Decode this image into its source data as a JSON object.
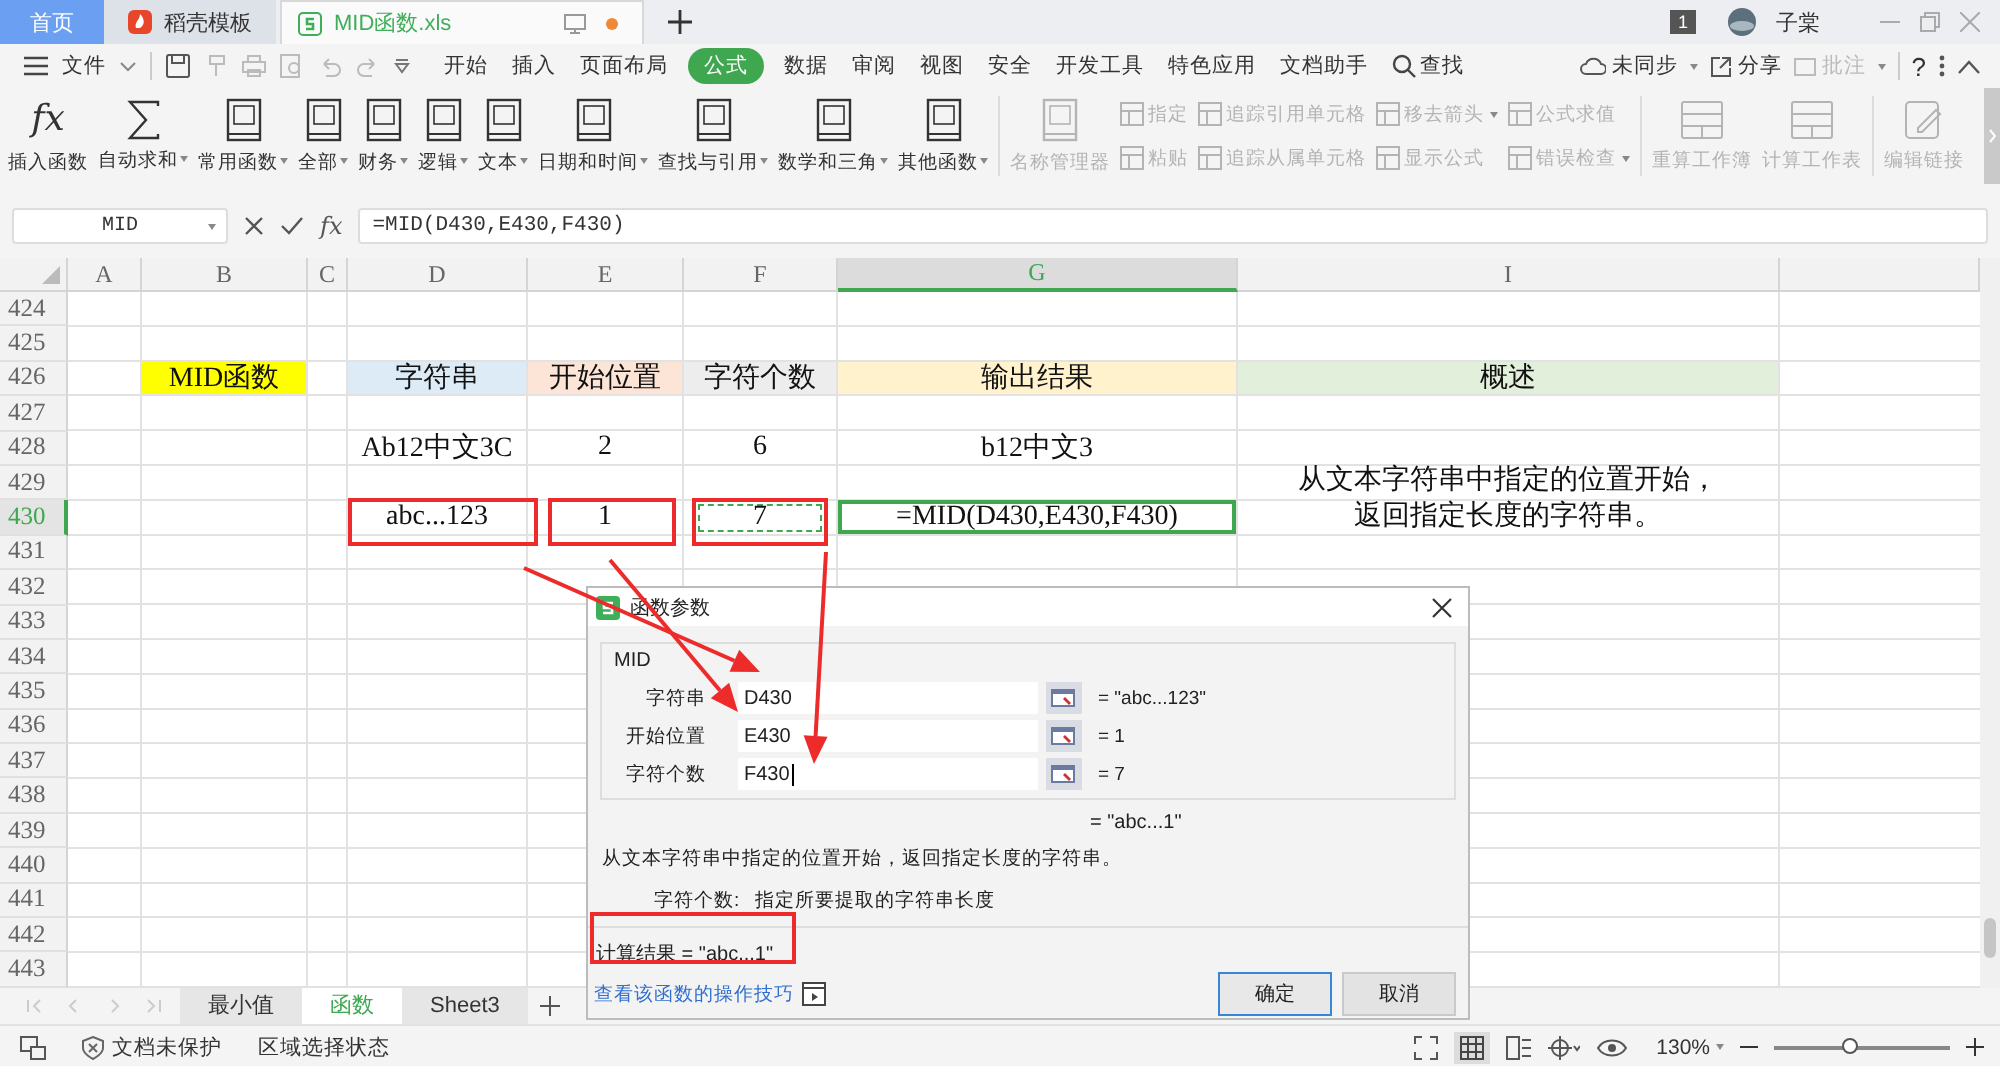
{
  "title_bar": {
    "tabs": [
      {
        "label": "首页",
        "kind": "home",
        "selected": false
      },
      {
        "label": "稻壳模板",
        "kind": "docer",
        "selected": false
      },
      {
        "label": "MID函数.xls",
        "kind": "sheet",
        "selected": true
      }
    ],
    "badge": "1",
    "user": "子棠"
  },
  "menu": {
    "file": "文件",
    "tabs": [
      {
        "label": "开始",
        "selected": false
      },
      {
        "label": "插入",
        "selected": false
      },
      {
        "label": "页面布局",
        "selected": false
      },
      {
        "label": "公式",
        "selected": true
      },
      {
        "label": "数据",
        "selected": false
      },
      {
        "label": "审阅",
        "selected": false
      },
      {
        "label": "视图",
        "selected": false
      },
      {
        "label": "安全",
        "selected": false
      },
      {
        "label": "开发工具",
        "selected": false
      },
      {
        "label": "特色应用",
        "selected": false
      },
      {
        "label": "文档助手",
        "selected": false
      }
    ],
    "search": "查找",
    "sync": "未同步",
    "share": "分享",
    "comment": "批注",
    "help": "?"
  },
  "ribbon": [
    {
      "kind": "fx",
      "icon_text": "fx",
      "label": "插入函数",
      "dropdown": false,
      "disabled": false
    },
    {
      "kind": "sigma",
      "label": "自动求和",
      "dropdown": true,
      "disabled": false
    },
    {
      "kind": "book",
      "label": "常用函数",
      "dropdown": true,
      "disabled": false
    },
    {
      "kind": "book",
      "label": "全部",
      "dropdown": true,
      "disabled": false
    },
    {
      "kind": "book",
      "label": "财务",
      "dropdown": true,
      "disabled": false
    },
    {
      "kind": "book",
      "label": "逻辑",
      "dropdown": true,
      "disabled": false
    },
    {
      "kind": "book",
      "label": "文本",
      "dropdown": true,
      "disabled": false
    },
    {
      "kind": "book",
      "label": "日期和时间",
      "dropdown": true,
      "disabled": false
    },
    {
      "kind": "book",
      "label": "查找与引用",
      "dropdown": true,
      "disabled": false
    },
    {
      "kind": "book",
      "label": "数学和三角",
      "dropdown": true,
      "disabled": false
    },
    {
      "kind": "book",
      "label": "其他函数",
      "dropdown": true,
      "disabled": false
    },
    {
      "kind": "book",
      "label": "名称管理器",
      "dropdown": false,
      "disabled": true
    },
    {
      "kind": "pair",
      "items": [
        {
          "label": "指定",
          "dropdown": false,
          "disabled": true
        },
        {
          "label": "粘贴",
          "dropdown": false,
          "disabled": true
        }
      ]
    },
    {
      "kind": "pair",
      "items": [
        {
          "label": "追踪引用单元格",
          "dropdown": false,
          "disabled": true
        },
        {
          "label": "追踪从属单元格",
          "dropdown": false,
          "disabled": true
        }
      ]
    },
    {
      "kind": "pair",
      "items": [
        {
          "label": "移去箭头",
          "dropdown": true,
          "disabled": true
        },
        {
          "label": "显示公式",
          "dropdown": false,
          "disabled": true
        }
      ]
    },
    {
      "kind": "pair",
      "items": [
        {
          "label": "公式求值",
          "dropdown": false,
          "disabled": true
        },
        {
          "label": "错误检查",
          "dropdown": true,
          "disabled": true
        }
      ]
    },
    {
      "kind": "table",
      "label": "重算工作簿",
      "dropdown": false,
      "disabled": true
    },
    {
      "kind": "table",
      "label": "计算工作表",
      "dropdown": false,
      "disabled": true
    },
    {
      "kind": "edit",
      "label": "编辑链接",
      "dropdown": false,
      "disabled": true
    }
  ],
  "formula_bar": {
    "name_box": "MID",
    "fx_label": "fx",
    "formula": "=MID(D430,E430,F430)"
  },
  "sheet": {
    "columns": [
      {
        "label": "A",
        "selected": false
      },
      {
        "label": "B",
        "selected": false
      },
      {
        "label": "C",
        "selected": false
      },
      {
        "label": "D",
        "selected": false
      },
      {
        "label": "E",
        "selected": false
      },
      {
        "label": "F",
        "selected": false
      },
      {
        "label": "G",
        "selected": true
      },
      {
        "label": "I",
        "selected": false
      }
    ],
    "rows": [
      {
        "number": "424",
        "selected": false
      },
      {
        "number": "425",
        "selected": false
      },
      {
        "number": "426",
        "selected": false,
        "cells": [
          null,
          {
            "text": "MID函数",
            "color": "#ffff00"
          },
          null,
          {
            "text": "字符串",
            "color": "#ddebf7"
          },
          {
            "text": "开始位置",
            "color": "#fce4d6"
          },
          {
            "text": "字符个数",
            "color": "#ededed"
          },
          {
            "text": "输出结果",
            "color": "#fff2cc"
          },
          {
            "text": "概述",
            "color": "#e2efda"
          }
        ]
      },
      {
        "number": "427",
        "selected": false
      },
      {
        "number": "428",
        "selected": false,
        "cells": [
          null,
          null,
          null,
          {
            "text": "Ab12中文3C"
          },
          {
            "text": "2"
          },
          {
            "text": "6"
          },
          {
            "text": "b12中文3"
          },
          null
        ]
      },
      {
        "number": "429",
        "selected": false,
        "cells": [
          null,
          null,
          null,
          null,
          null,
          null,
          null,
          {
            "lines": [
              "从文本字符串中指定的位置开始，",
              "返回指定长度的字符串。"
            ],
            "merged_down": true
          }
        ]
      },
      {
        "number": "430",
        "selected": true,
        "cells": [
          null,
          null,
          null,
          {
            "text": "abc...123"
          },
          {
            "text": "1"
          },
          {
            "text": "7",
            "marquee": true
          },
          {
            "text": "=MID(D430,E430,F430)",
            "active": true
          },
          null
        ]
      },
      {
        "number": "431",
        "selected": false
      },
      {
        "number": "432",
        "selected": false
      },
      {
        "number": "433",
        "selected": false
      },
      {
        "number": "434",
        "selected": false
      },
      {
        "number": "435",
        "selected": false
      },
      {
        "number": "436",
        "selected": false
      },
      {
        "number": "437",
        "selected": false
      },
      {
        "number": "438",
        "selected": false
      },
      {
        "number": "439",
        "selected": false
      },
      {
        "number": "440",
        "selected": false
      },
      {
        "number": "441",
        "selected": false
      },
      {
        "number": "442",
        "selected": false
      },
      {
        "number": "443",
        "selected": false
      }
    ],
    "tabs": [
      {
        "label": "最小值",
        "selected": false
      },
      {
        "label": "函数",
        "selected": true
      },
      {
        "label": "Sheet3",
        "selected": false
      }
    ]
  },
  "dialog": {
    "title": "函数参数",
    "function": "MID",
    "args": [
      {
        "label": "字符串",
        "value": "D430",
        "result": "= \"abc...123\"",
        "focused": false
      },
      {
        "label": "开始位置",
        "value": "E430",
        "result": "= 1",
        "focused": false
      },
      {
        "label": "字符个数",
        "value": "F430",
        "result": "= 7",
        "focused": true
      }
    ],
    "result": "= \"abc...1\"",
    "description": "从文本字符串中指定的位置开始，返回指定长度的字符串。",
    "arg_name": "字符个数:",
    "arg_help": "指定所要提取的字符串长度",
    "calc_result": "计算结果 = \"abc...1\"",
    "link": "查看该函数的操作技巧",
    "buttons": [
      {
        "label": "确定",
        "default": true
      },
      {
        "label": "取消",
        "default": false
      }
    ]
  },
  "status_bar": {
    "protection": "文档未保护",
    "selection": "区域选择状态",
    "zoom": "130%",
    "zoom_slider": {
      "level": 0.43
    }
  }
}
